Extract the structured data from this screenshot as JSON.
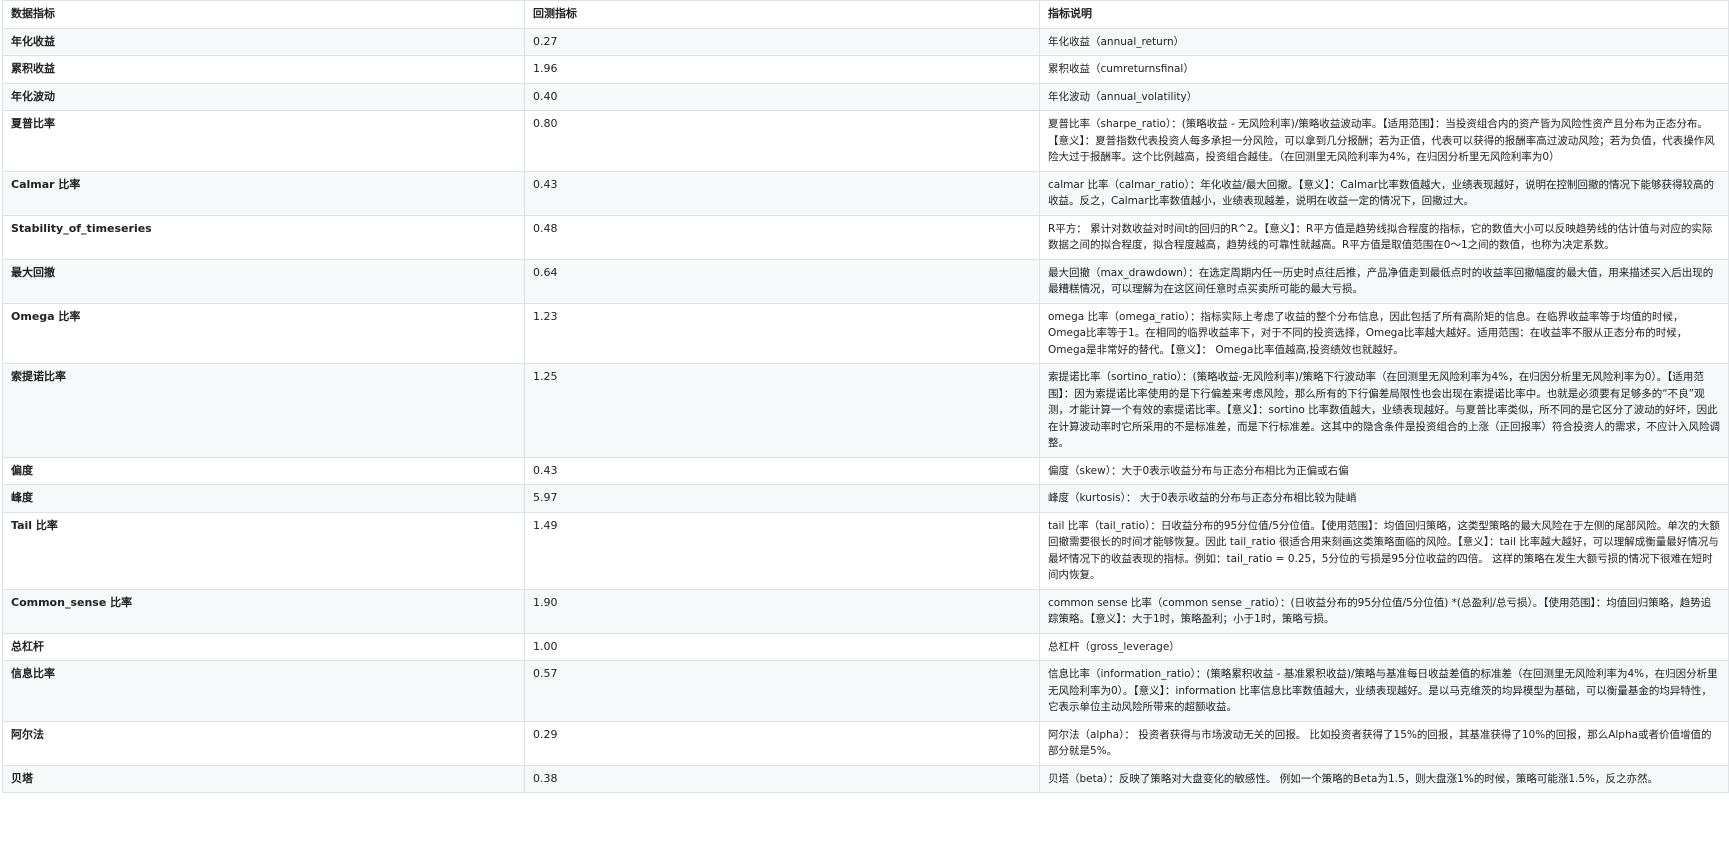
{
  "table": {
    "headers": [
      "数据指标",
      "回测指标",
      "指标说明"
    ],
    "rows": [
      {
        "name": "年化收益",
        "value": "0.27",
        "desc": "年化收益（annual_return）"
      },
      {
        "name": "累积收益",
        "value": "1.96",
        "desc": "累积收益（cumreturnsfinal）"
      },
      {
        "name": "年化波动",
        "value": "0.40",
        "desc": "年化波动（annual_volatility）"
      },
      {
        "name": "夏普比率",
        "value": "0.80",
        "desc": "夏普比率（sharpe_ratio）：(策略收益 - 无风险利率)/策略收益波动率。【适用范围】：当投资组合内的资产皆为风险性资产且分布为正态分布。【意义】：夏普指数代表投资人每多承担一分风险，可以拿到几分报酬；若为正值，代表可以获得的报酬率高过波动风险；若为负值，代表操作风险大过于报酬率。这个比例越高，投资组合越佳。（在回测里无风险利率为4%，在归因分析里无风险利率为0）"
      },
      {
        "name": "Calmar 比率",
        "value": "0.43",
        "desc": "calmar 比率（calmar_ratio）：年化收益/最大回撤。【意义】：Calmar比率数值越大，业绩表现越好，说明在控制回撤的情况下能够获得较高的收益。反之，Calmar比率数值越小，业绩表现越差，说明在收益一定的情况下，回撤过大。"
      },
      {
        "name": "Stability_of_timeseries",
        "value": "0.48",
        "desc": "R平方： 累计对数收益对时间t的回归的R^2。【意义】：R平方值是趋势线拟合程度的指标，它的数值大小可以反映趋势线的估计值与对应的实际数据之间的拟合程度，拟合程度越高，趋势线的可靠性就越高。R平方值是取值范围在0～1之间的数值，也称为决定系数。"
      },
      {
        "name": "最大回撤",
        "value": "0.64",
        "desc": "最大回撤（max_drawdown）：在选定周期内任一历史时点往后推，产品净值走到最低点时的收益率回撤幅度的最大值，用来描述买入后出现的最糟糕情况，可以理解为在这区间任意时点买卖所可能的最大亏损。"
      },
      {
        "name": "Omega 比率",
        "value": "1.23",
        "desc": "omega 比率（omega_ratio）：指标实际上考虑了收益的整个分布信息，因此包括了所有高阶矩的信息。在临界收益率等于均值的时候，Omega比率等于1。在相同的临界收益率下，对于不同的投资选择，Omega比率越大越好。适用范围：在收益率不服从正态分布的时候，Omega是非常好的替代。【意义】： Omega比率值越高,投资绩效也就越好。"
      },
      {
        "name": "索提诺比率",
        "value": "1.25",
        "desc": "索提诺比率（sortino_ratio）：(策略收益-无风险利率)/策略下行波动率（在回测里无风险利率为4%，在归因分析里无风险利率为0）。【适用范围】：因为索提诺比率使用的是下行偏差来考虑风险，那么所有的下行偏差局限性也会出现在索提诺比率中。也就是必须要有足够多的“不良”观测，才能计算一个有效的索提诺比率。【意义】：sortino 比率数值越大，业绩表现越好。与夏普比率类似，所不同的是它区分了波动的好坏，因此在计算波动率时它所采用的不是标准差，而是下行标准差。这其中的隐含条件是投资组合的上涨（正回报率）符合投资人的需求，不应计入风险调整。"
      },
      {
        "name": "偏度",
        "value": "0.43",
        "desc": "偏度（skew）：大于0表示收益分布与正态分布相比为正偏或右偏"
      },
      {
        "name": "峰度",
        "value": "5.97",
        "desc": "峰度（kurtosis）： 大于0表示收益的分布与正态分布相比较为陡峭"
      },
      {
        "name": "Tail 比率",
        "value": "1.49",
        "desc": "tail 比率（tail_ratio）：日收益分布的95分位值/5分位值。【使用范围】：均值回归策略，这类型策略的最大风险在于左侧的尾部风险。单次的大额回撤需要很长的时间才能够恢复。因此 tail_ratio 很适合用来刻画这类策略面临的风险。【意义】：tail 比率越大越好，可以理解成衡量最好情况与最坏情况下的收益表现的指标。例如：tail_ratio = 0.25，5分位的亏损是95分位收益的四倍。 这样的策略在发生大额亏损的情况下很难在短时间内恢复。"
      },
      {
        "name": "Common_sense 比率",
        "value": "1.90",
        "desc": "common sense 比率（common sense _ratio）：(日收益分布的95分位值/5分位值) *(总盈利/总亏损）。【使用范围】：均值回归策略，趋势追踪策略。【意义】：大于1时，策略盈利；小于1时，策略亏损。"
      },
      {
        "name": "总杠杆",
        "value": "1.00",
        "desc": "总杠杆（gross_leverage）"
      },
      {
        "name": "信息比率",
        "value": "0.57",
        "desc": "信息比率（information_ratio）：(策略累积收益 - 基准累积收益)/策略与基准每日收益差值的标准差（在回测里无风险利率为4%，在归因分析里无风险利率为0）。【意义】：information 比率信息比率数值越大，业绩表现越好。是以马克维茨的均异模型为基础，可以衡量基金的均异特性，它表示单位主动风险所带来的超额收益。"
      },
      {
        "name": "阿尔法",
        "value": "0.29",
        "desc": "阿尔法（alpha）： 投资者获得与市场波动无关的回报。 比如投资者获得了15%的回报，其基准获得了10%的回报，那么Alpha或者价值增值的部分就是5%。"
      },
      {
        "name": "贝塔",
        "value": "0.38",
        "desc": "贝塔（beta）：反映了策略对大盘变化的敏感性。 例如一个策略的Beta为1.5，则大盘涨1%的时候，策略可能涨1.5%，反之亦然。"
      }
    ]
  }
}
